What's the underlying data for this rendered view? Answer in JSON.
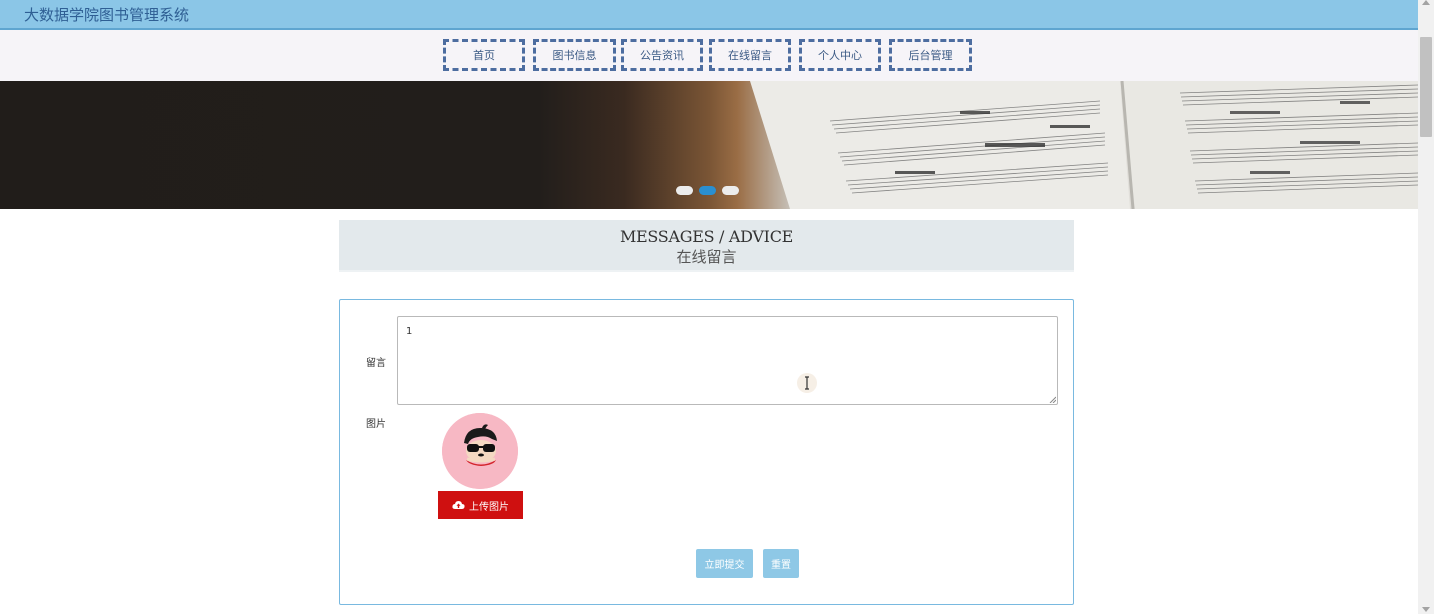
{
  "site": {
    "title": "大数据学院图书管理系统"
  },
  "nav": {
    "items": [
      {
        "label": "首页"
      },
      {
        "label": "图书信息"
      },
      {
        "label": "公告资讯"
      },
      {
        "label": "在线留言"
      },
      {
        "label": "个人中心"
      },
      {
        "label": "后台管理"
      }
    ]
  },
  "banner": {
    "active_slide": 2,
    "slide_count": 3
  },
  "section": {
    "title_en": "MESSAGES / ADVICE",
    "title_cn": "在线留言"
  },
  "form": {
    "message_label": "留言",
    "message_value": "1",
    "image_label": "图片",
    "upload_label": "上传图片",
    "upload_icon": "cloud-upload-icon",
    "submit_label": "立即提交",
    "reset_label": "重置"
  },
  "colors": {
    "topbar": "#8bc6e7",
    "nav_border": "#4d6da0",
    "upload_button": "#cf1010",
    "action_button": "#8ec8e6",
    "form_border": "#79b9e0"
  }
}
